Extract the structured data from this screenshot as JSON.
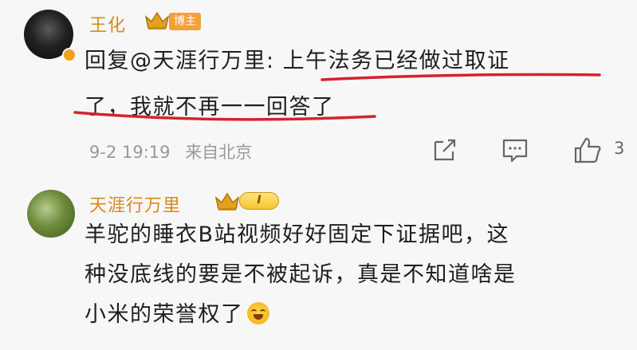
{
  "comments": [
    {
      "author": "王化",
      "author_tag": "博主",
      "mention": "@天涯行万里",
      "reply_prefix": "回复",
      "text_line1_after": ": 上午法务已经做过取证",
      "text_line2": "了，我就不再一一回答了",
      "date": "9-2 19:19",
      "location": "来自北京",
      "like_count": "3"
    },
    {
      "author": "天涯行万里",
      "level_badge": "I",
      "text_line1": "羊驼的睡衣B站视频好好固定下证据吧，这",
      "text_line2": "种没底线的要是不被起诉，真是不知道啥是",
      "text_line3": "小米的荣誉权了"
    }
  ],
  "colors": {
    "author_name": "#d9881a",
    "underline": "#d4232f",
    "meta": "#999999",
    "owner_tag": "#f2a13b"
  },
  "icons": [
    "share-icon",
    "comment-icon",
    "like-icon",
    "crown-icon",
    "laugh-cry-emoji"
  ]
}
